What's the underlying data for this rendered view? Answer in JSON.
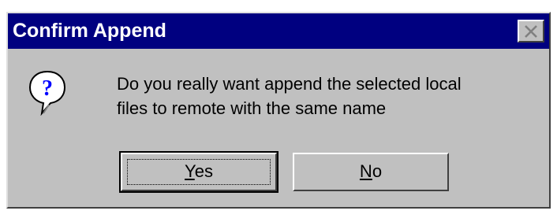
{
  "dialog": {
    "title": "Confirm Append",
    "message_line1": "Do you really want append the selected local",
    "message_line2": "files to remote with the same name",
    "icon": "question-icon",
    "close_icon": "close-icon"
  },
  "buttons": {
    "yes": {
      "accel": "Y",
      "rest": "es",
      "label": "Yes",
      "focused": true
    },
    "no": {
      "accel": "N",
      "rest": "o",
      "label": "No",
      "focused": false
    }
  },
  "colors": {
    "titlebar": "#000080",
    "face": "#c0c0c0",
    "title_text": "#ffffff"
  }
}
